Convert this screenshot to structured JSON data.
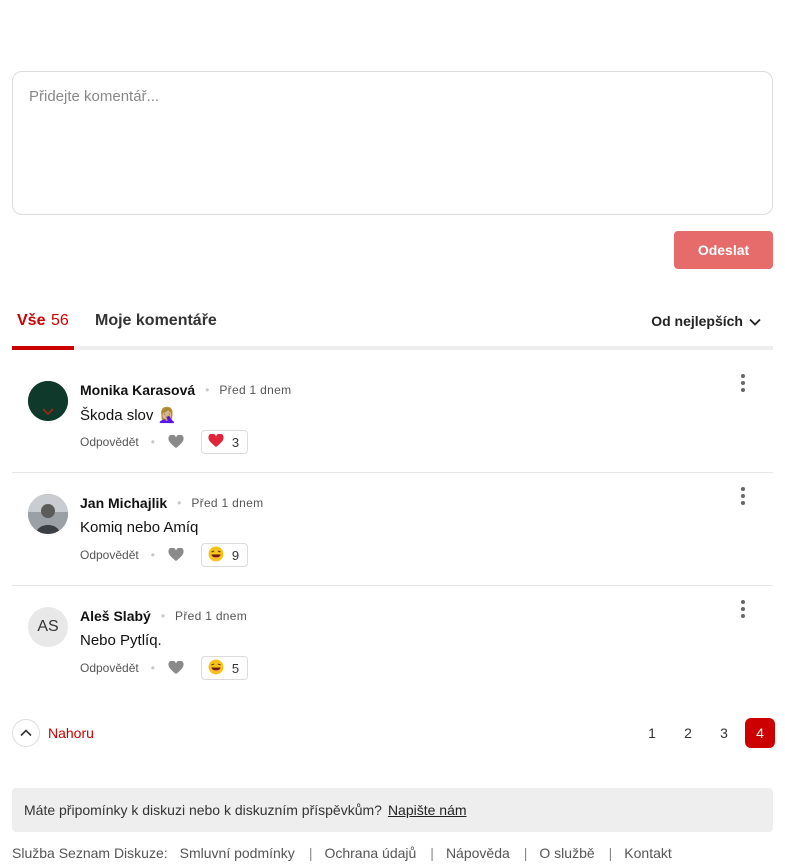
{
  "composer": {
    "placeholder": "Přidejte komentář...",
    "send_label": "Odeslat"
  },
  "tabs": {
    "all_label": "Vše",
    "all_count": "56",
    "mine_label": "Moje komentáře",
    "sort_label": "Od nejlepších"
  },
  "comments": [
    {
      "author": "Monika Karasová",
      "time": "Před 1 dnem",
      "text": "Škoda slov 🤦🏼‍♀️",
      "reply_label": "Odpovědět",
      "reaction_icon": "heart-reaction-icon",
      "reaction_count": "3"
    },
    {
      "author": "Jan Michajlik",
      "time": "Před 1 dnem",
      "text": "Komiq nebo Amíq",
      "reply_label": "Odpovědět",
      "reaction_icon": "laughing-face-icon",
      "reaction_count": "9"
    },
    {
      "author": "Aleš Slabý",
      "initials": "AS",
      "time": "Před 1 dnem",
      "text": "Nebo Pytlíq.",
      "reply_label": "Odpovědět",
      "reaction_icon": "laughing-face-icon",
      "reaction_count": "5"
    }
  ],
  "pagination": {
    "top_label": "Nahoru",
    "pages": [
      "1",
      "2",
      "3",
      "4"
    ],
    "current": "4"
  },
  "feedback": {
    "question": "Máte připomínky k diskuzi nebo k diskuzním příspěvkům?",
    "link": "Napište nám"
  },
  "footer": {
    "service": "Služba Seznam Diskuze:",
    "links": [
      "Smluvní podmínky",
      "Ochrana údajů",
      "Nápověda",
      "O službě",
      "Kontakt"
    ]
  },
  "colors": {
    "accent": "#cc0000",
    "send_button": "#e66b6b",
    "reaction_heart": "#e0243a"
  }
}
